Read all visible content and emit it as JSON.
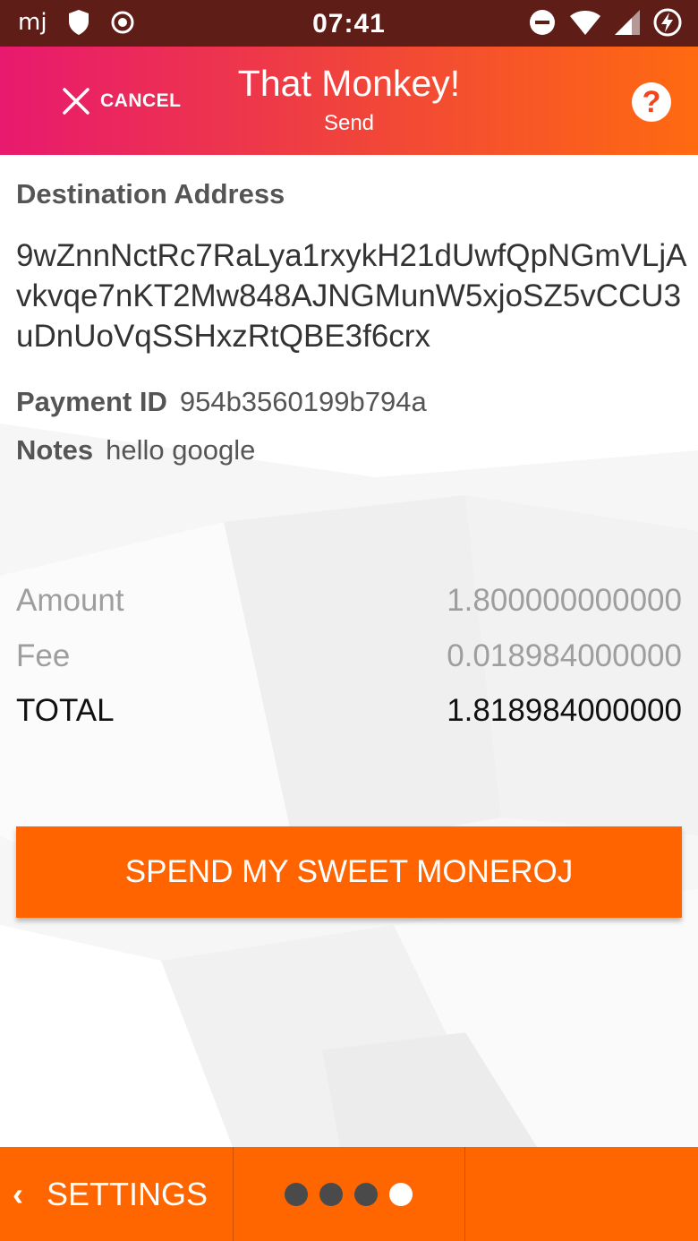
{
  "status_bar": {
    "time": "07:41",
    "left_icons": [
      "mj-icon",
      "shield-icon",
      "record-icon"
    ],
    "right_icons": [
      "dnd-icon",
      "wifi-icon",
      "signal-icon",
      "battery-charging-icon"
    ]
  },
  "app_bar": {
    "cancel_label": "CANCEL",
    "title": "That Monkey!",
    "subtitle": "Send",
    "help_glyph": "?"
  },
  "form": {
    "destination_label": "Destination Address",
    "destination_address": "9wZnnNctRc7RaLya1rxykH21dUwfQpNGmVLjAvkvqe7nKT2Mw848AJNGMunW5xjoSZ5vCCU3uDnUoVqSSHxzRtQBE3f6crx",
    "payment_id_label": "Payment ID",
    "payment_id": "954b3560199b794a",
    "notes_label": "Notes",
    "notes": "hello google"
  },
  "amounts": {
    "amount_label": "Amount",
    "amount_value": "1.800000000000",
    "fee_label": "Fee",
    "fee_value": "0.018984000000",
    "total_label": "TOTAL",
    "total_value": "1.818984000000"
  },
  "spend_button_label": "SPEND MY SWEET MONEROJ",
  "bottom_bar": {
    "settings_label": "SETTINGS",
    "page_count": 4,
    "active_page": 4
  },
  "colors": {
    "status_bar": "#5e1d17",
    "gradient_start": "#e8196e",
    "gradient_end": "#ff6a10",
    "accent": "#ff6400"
  }
}
